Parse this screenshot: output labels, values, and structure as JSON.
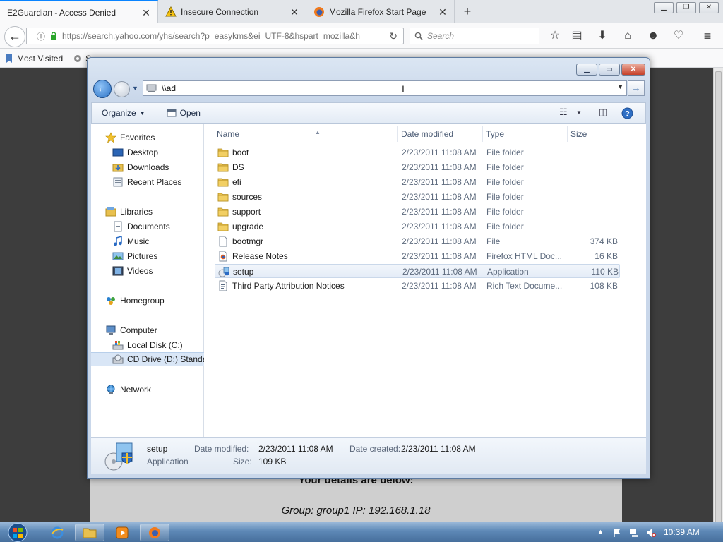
{
  "browser": {
    "tabs": [
      {
        "label": "E2Guardian - Access Denied",
        "active": true
      },
      {
        "label": "Insecure Connection",
        "active": false
      },
      {
        "label": "Mozilla Firefox Start Page",
        "active": false
      }
    ],
    "new_tab": "+",
    "url": "https://search.yahoo.com/yhs/search?p=easykms&ei=UTF-8&hspart=mozilla&h",
    "search_placeholder": "Search",
    "bookmarks": [
      {
        "label": "Most Visited"
      },
      {
        "label": "S"
      }
    ]
  },
  "page": {
    "details_heading": "Your details are below:",
    "group_line": "Group: group1   IP: 192.168.1.18"
  },
  "explorer": {
    "address": "\\\\ad",
    "toolbar": {
      "organize": "Organize",
      "open": "Open"
    },
    "nav": {
      "favorites": "Favorites",
      "desktop": "Desktop",
      "downloads": "Downloads",
      "recent_places": "Recent Places",
      "libraries": "Libraries",
      "documents": "Documents",
      "music": "Music",
      "pictures": "Pictures",
      "videos": "Videos",
      "homegroup": "Homegroup",
      "computer": "Computer",
      "local_disk": "Local Disk (C:)",
      "cd_drive": "CD Drive (D:) Standa",
      "network": "Network"
    },
    "columns": {
      "name": "Name",
      "date_modified": "Date modified",
      "type": "Type",
      "size": "Size"
    },
    "files": [
      {
        "name": "boot",
        "date": "2/23/2011 11:08 AM",
        "type": "File folder",
        "size": "",
        "icon": "folder-icon"
      },
      {
        "name": "DS",
        "date": "2/23/2011 11:08 AM",
        "type": "File folder",
        "size": "",
        "icon": "folder-icon"
      },
      {
        "name": "efi",
        "date": "2/23/2011 11:08 AM",
        "type": "File folder",
        "size": "",
        "icon": "folder-icon"
      },
      {
        "name": "sources",
        "date": "2/23/2011 11:08 AM",
        "type": "File folder",
        "size": "",
        "icon": "folder-icon"
      },
      {
        "name": "support",
        "date": "2/23/2011 11:08 AM",
        "type": "File folder",
        "size": "",
        "icon": "folder-icon"
      },
      {
        "name": "upgrade",
        "date": "2/23/2011 11:08 AM",
        "type": "File folder",
        "size": "",
        "icon": "folder-icon"
      },
      {
        "name": "bootmgr",
        "date": "2/23/2011 11:08 AM",
        "type": "File",
        "size": "374 KB",
        "icon": "file-icon"
      },
      {
        "name": "Release Notes",
        "date": "2/23/2011 11:08 AM",
        "type": "Firefox HTML Doc...",
        "size": "16 KB",
        "icon": "html-file-icon"
      },
      {
        "name": "setup",
        "date": "2/23/2011 11:08 AM",
        "type": "Application",
        "size": "110 KB",
        "icon": "setup-app-icon"
      },
      {
        "name": "Third Party Attribution Notices",
        "date": "2/23/2011 11:08 AM",
        "type": "Rich Text Docume...",
        "size": "108 KB",
        "icon": "rtf-file-icon"
      }
    ],
    "details": {
      "name": "setup",
      "type": "Application",
      "date_modified_label": "Date modified:",
      "date_modified": "2/23/2011 11:08 AM",
      "date_created_label": "Date created:",
      "date_created": "2/23/2011 11:08 AM",
      "size_label": "Size:",
      "size": "109 KB"
    }
  },
  "taskbar": {
    "clock": "10:39 AM"
  },
  "colors": {
    "firefox_accent": "#0a84ff",
    "explorer_frame": "#c9d7ea",
    "folder_yellow": "#e8c04f",
    "taskbar": "#5d88b6"
  }
}
